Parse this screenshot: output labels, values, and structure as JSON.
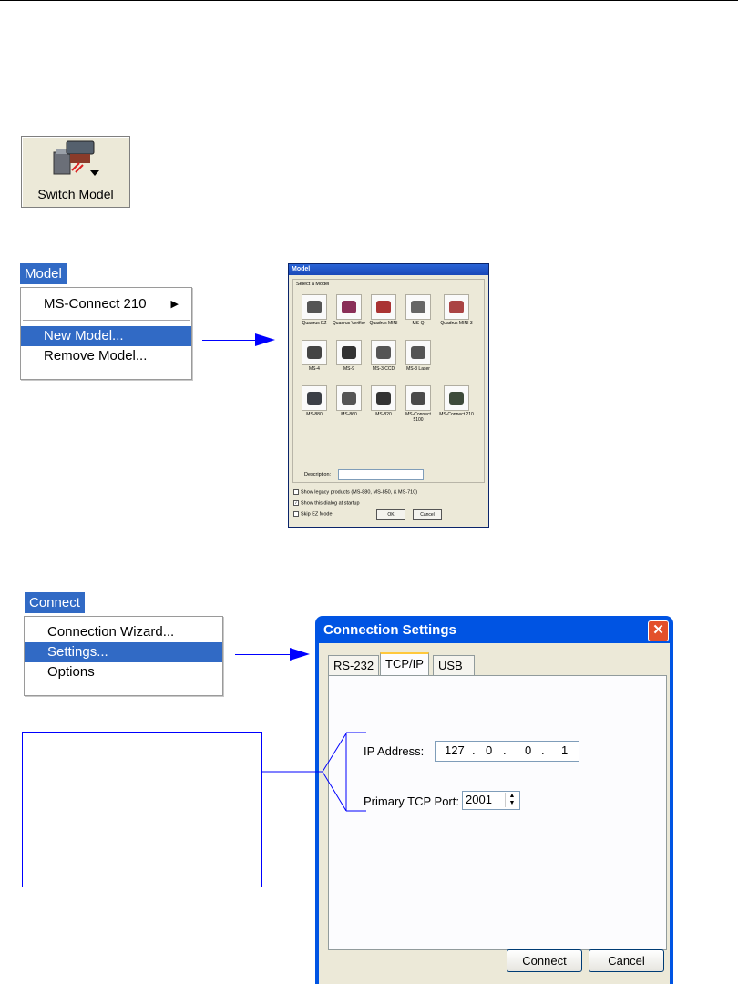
{
  "switch_button": {
    "label": "Switch Model",
    "icon": "scanner-switch-icon"
  },
  "model_menu": {
    "title": "Model",
    "items": [
      "MS-Connect 210",
      "New Model...",
      "Remove Model..."
    ],
    "selected": "New Model..."
  },
  "model_dialog": {
    "title": "Model",
    "group_label": "Select a Model",
    "models": [
      "Quadrus EZ",
      "Quadrus Verifier",
      "Quadrus MINI",
      "MS-Q",
      "Quadrus MINI 3",
      "MS-4",
      "MS-9",
      "MS-3 CCD",
      "MS-3 Laser",
      "MS-880",
      "MS-860",
      "MS-820",
      "MS-Connect 5100",
      "MS-Connect 210"
    ],
    "description_label": "Description:",
    "checkboxes": [
      {
        "label": "Show legacy products (MS-880, MS-850, & MS-710)",
        "checked": false
      },
      {
        "label": "Show this dialog at startup",
        "checked": true
      },
      {
        "label": "Skip EZ Mode",
        "checked": false
      }
    ],
    "ok": "OK",
    "cancel": "Cancel"
  },
  "connect_menu": {
    "title": "Connect",
    "items": [
      "Connection Wizard...",
      "Settings...",
      "Options"
    ],
    "selected": "Settings..."
  },
  "connection_dialog": {
    "title": "Connection Settings",
    "tabs": [
      "RS-232",
      "TCP/IP",
      "USB"
    ],
    "active_tab": "TCP/IP",
    "ip_label": "IP Address:",
    "ip_octets": [
      "127",
      "0",
      "0",
      "1"
    ],
    "port_label": "Primary TCP Port:",
    "port_value": "2001",
    "connect": "Connect",
    "cancel": "Cancel"
  },
  "colors": {
    "accent": "#316ac5",
    "title_bar": "#0054e3",
    "arrow": "#0000ff",
    "dialog_bg": "#ece9d8"
  }
}
